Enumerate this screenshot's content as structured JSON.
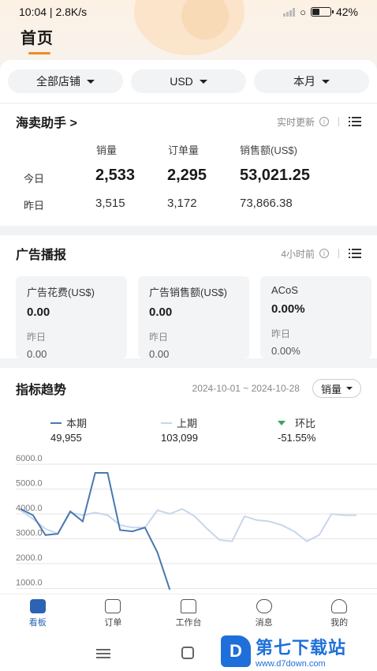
{
  "status": {
    "time": "10:04 | 2.8K/s",
    "battery": "42"
  },
  "header": {
    "title": "首页"
  },
  "filters": [
    {
      "label": "全部店铺"
    },
    {
      "label": "USD"
    },
    {
      "label": "本月"
    }
  ],
  "sales": {
    "title": "海卖助手",
    "realtime": "实时更新",
    "columns": [
      "销量",
      "订单量",
      "销售额(US$)"
    ],
    "rows": [
      {
        "label": "今日",
        "values": [
          "2,533",
          "2,295",
          "53,021.25"
        ]
      },
      {
        "label": "昨日",
        "values": [
          "3,515",
          "3,172",
          "73,866.38"
        ]
      }
    ]
  },
  "ads": {
    "title": "广告播报",
    "updated": "4小时前",
    "boxes": [
      {
        "label": "广告花费(US$)",
        "value": "0.00",
        "sub": "昨日",
        "subval": "0.00"
      },
      {
        "label": "广告销售额(US$)",
        "value": "0.00",
        "sub": "昨日",
        "subval": "0.00"
      },
      {
        "label": "ACoS",
        "value": "0.00%",
        "sub": "昨日",
        "subval": "0.00%"
      }
    ]
  },
  "trend": {
    "title": "指标趋势",
    "range": "2024-10-01 ~ 2024-10-28",
    "metric": "销量",
    "legend": [
      {
        "name": "本期",
        "value": "49,955",
        "color": "#4a78b0"
      },
      {
        "name": "上期",
        "value": "103,099",
        "color": "#c7d6ea"
      },
      {
        "name": "环比",
        "value": "-51.55%",
        "color": "#3aa55a"
      }
    ]
  },
  "chart_data": {
    "type": "line",
    "yticks": [
      "6000.0",
      "5000.0",
      "4000.0",
      "3000.0",
      "2000.0",
      "1000.0"
    ],
    "ylim": [
      1000,
      6000
    ],
    "x": [
      1,
      2,
      3,
      4,
      5,
      6,
      7,
      8,
      9,
      10,
      11,
      12,
      13,
      14,
      15,
      16,
      17,
      18,
      19,
      20,
      21,
      22,
      23,
      24,
      25,
      26,
      27,
      28
    ],
    "series": [
      {
        "name": "本期",
        "color": "#4a78b0",
        "values": [
          4200,
          3950,
          3150,
          3200,
          4100,
          3700,
          5650,
          5650,
          3350,
          3300,
          3450,
          2450,
          950
        ]
      },
      {
        "name": "上期",
        "color": "#c7d6ea",
        "values": [
          4150,
          3800,
          3400,
          3200,
          4050,
          3950,
          4050,
          3950,
          3550,
          3450,
          3450,
          4150,
          4000,
          4200,
          3900,
          3400,
          2950,
          2900,
          3900,
          3750,
          3700,
          3550,
          3300,
          2900,
          3150,
          4000,
          3950,
          3950
        ]
      }
    ]
  },
  "tabs": [
    {
      "label": "看板",
      "active": true
    },
    {
      "label": "订单"
    },
    {
      "label": "工作台"
    },
    {
      "label": "消息"
    },
    {
      "label": "我的"
    }
  ],
  "watermark": {
    "name": "第七下载站",
    "url": "www.d7down.com"
  }
}
